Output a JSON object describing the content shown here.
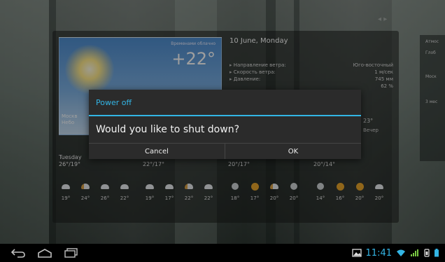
{
  "colors": {
    "accent": "#33b5e5",
    "dialog_bg": "#2b2b2b",
    "status_green": "#7ac943"
  },
  "weather_widget": {
    "condition": "Временами облачно",
    "temperature": "+22°",
    "city_line1": "Москв",
    "city_line2": "Небо",
    "date": "10 June, Monday",
    "details": [
      {
        "label": "Направление ветра:",
        "value": "Юго-восточный"
      },
      {
        "label": "Скорость ветра:",
        "value": "1 м/сек"
      },
      {
        "label": "Давление:",
        "value": "745 мм"
      },
      {
        "label": "",
        "value": "62 %"
      }
    ],
    "partial_temp": "23°",
    "partial_period": "Вечер",
    "forecast": [
      {
        "day": "Tuesday",
        "range": "26°/19°",
        "icons": [
          "cloud-moon-icon",
          "cloudy-sun-icon",
          "cloud-icon",
          "cloud-icon"
        ],
        "temps": [
          "19°",
          "24°",
          "26°",
          "22°"
        ]
      },
      {
        "day": "",
        "range": "22°/17°",
        "icons": [
          "cloud-icon",
          "cloud-icon",
          "cloudy-sun-icon",
          "cloud-icon"
        ],
        "temps": [
          "19°",
          "17°",
          "22°",
          "22°"
        ]
      },
      {
        "day": "",
        "range": "20°/17°",
        "icons": [
          "moon-icon",
          "sun-icon",
          "cloudy-sun-icon",
          "moon-icon"
        ],
        "temps": [
          "18°",
          "17°",
          "20°",
          "20°"
        ]
      },
      {
        "day": "",
        "range": "20°/14°",
        "icons": [
          "moon-icon",
          "sun-icon",
          "sun-icon",
          "cloud-icon"
        ],
        "temps": [
          "14°",
          "16°",
          "20°",
          "20°"
        ]
      }
    ]
  },
  "side_widget": {
    "lines": [
      "Атмос",
      "Глоб",
      "Моск",
      "3 мес"
    ]
  },
  "dialog": {
    "title": "Power off",
    "message": "Would you like to shut down?",
    "cancel_label": "Cancel",
    "ok_label": "OK"
  },
  "navbar": {
    "back_icon": "back-icon",
    "home_icon": "home-icon",
    "recents_icon": "recent-apps-icon",
    "clock": "11:41"
  }
}
